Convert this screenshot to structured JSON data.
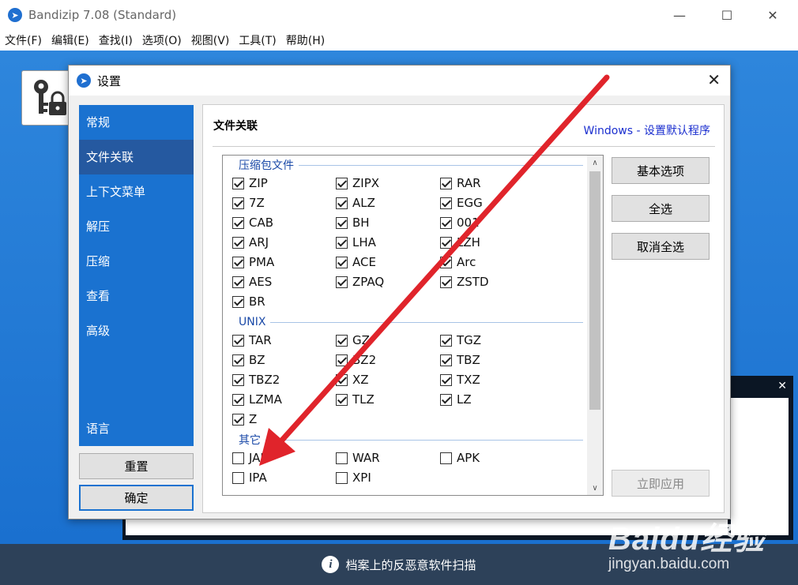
{
  "app": {
    "title": "Bandizip 7.08 (Standard)",
    "icon": "bandizip-logo-icon",
    "minimize": "—",
    "maximize": "☐",
    "close": "✕",
    "menu": [
      "文件(F)",
      "编辑(E)",
      "查找(I)",
      "选项(O)",
      "视图(V)",
      "工具(T)",
      "帮助(H)"
    ],
    "bottom_bar_text": "档案上的反恶意软件扫描"
  },
  "dialog": {
    "title": "设置",
    "close": "✕",
    "sidebar": {
      "items": [
        "常规",
        "文件关联",
        "上下文菜单",
        "解压",
        "压缩",
        "查看",
        "高级"
      ],
      "active_index": 1,
      "language": "语言"
    },
    "reset_button": "重置",
    "ok_button": "确定",
    "content": {
      "section_title": "文件关联",
      "windows_link": "Windows - 设置默认程序",
      "groups": [
        {
          "label": "压缩包文件",
          "items": [
            {
              "name": "ZIP",
              "checked": true
            },
            {
              "name": "ZIPX",
              "checked": true
            },
            {
              "name": "RAR",
              "checked": true
            },
            {
              "name": "7Z",
              "checked": true
            },
            {
              "name": "ALZ",
              "checked": true
            },
            {
              "name": "EGG",
              "checked": true
            },
            {
              "name": "CAB",
              "checked": true
            },
            {
              "name": "BH",
              "checked": true
            },
            {
              "name": "001",
              "checked": true
            },
            {
              "name": "ARJ",
              "checked": true
            },
            {
              "name": "LHA",
              "checked": true
            },
            {
              "name": "LZH",
              "checked": true
            },
            {
              "name": "PMA",
              "checked": true
            },
            {
              "name": "ACE",
              "checked": true
            },
            {
              "name": "Arc",
              "checked": true
            },
            {
              "name": "AES",
              "checked": true
            },
            {
              "name": "ZPAQ",
              "checked": true
            },
            {
              "name": "ZSTD",
              "checked": true
            },
            {
              "name": "BR",
              "checked": true
            }
          ]
        },
        {
          "label": "UNIX",
          "items": [
            {
              "name": "TAR",
              "checked": true
            },
            {
              "name": "GZ",
              "checked": true
            },
            {
              "name": "TGZ",
              "checked": true
            },
            {
              "name": "BZ",
              "checked": true
            },
            {
              "name": "BZ2",
              "checked": true
            },
            {
              "name": "TBZ",
              "checked": true
            },
            {
              "name": "TBZ2",
              "checked": true
            },
            {
              "name": "XZ",
              "checked": true
            },
            {
              "name": "TXZ",
              "checked": true
            },
            {
              "name": "LZMA",
              "checked": true
            },
            {
              "name": "TLZ",
              "checked": true
            },
            {
              "name": "LZ",
              "checked": true
            },
            {
              "name": "Z",
              "checked": true
            }
          ]
        },
        {
          "label": "其它",
          "items": [
            {
              "name": "JAR",
              "checked": false
            },
            {
              "name": "WAR",
              "checked": false
            },
            {
              "name": "APK",
              "checked": false
            },
            {
              "name": "IPA",
              "checked": false
            },
            {
              "name": "XPI",
              "checked": false
            }
          ]
        }
      ],
      "scroll_up": "∧",
      "scroll_down": "∨",
      "buttons": {
        "basic": "基本选项",
        "select_all": "全选",
        "deselect_all": "取消全选",
        "apply": "立即应用"
      }
    }
  },
  "watermark": {
    "brand": "Baidu经验",
    "url": "jingyan.baidu.com"
  },
  "bg_panel_close": "✕",
  "annotation_color": "#e0242b",
  "accent_color": "#1a72d0"
}
